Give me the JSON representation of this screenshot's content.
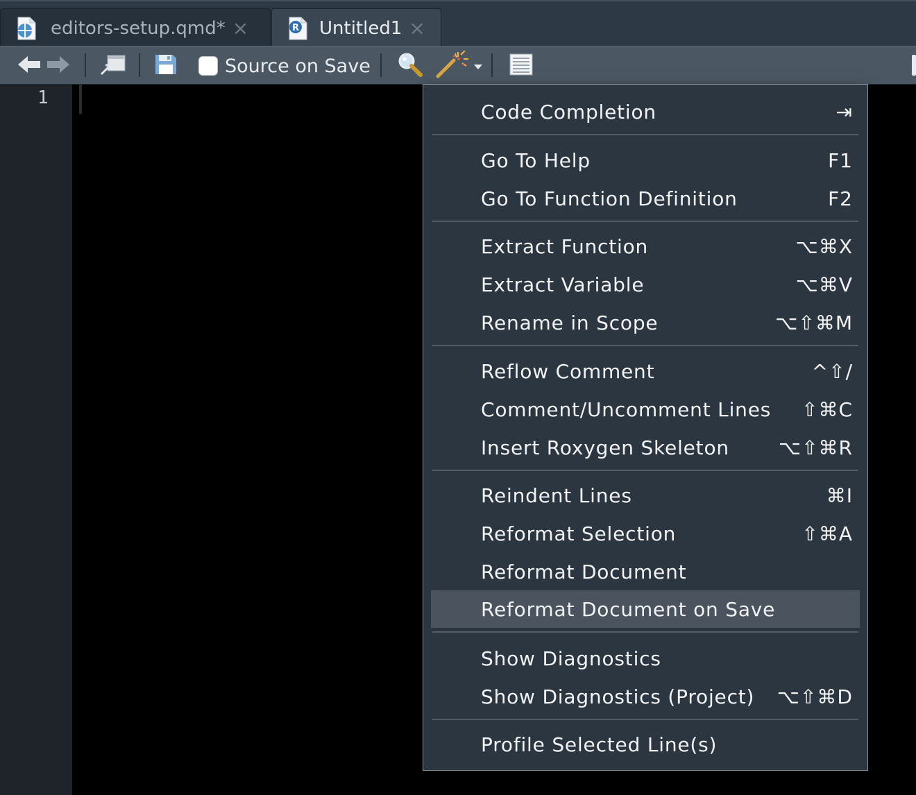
{
  "tabs": [
    {
      "label": "editors-setup.qmd*",
      "icon": "quarto-document-icon",
      "close": "×"
    },
    {
      "label": "Untitled1",
      "icon": "r-script-icon",
      "icon_letter": "R",
      "close": "×"
    }
  ],
  "toolbar": {
    "back_icon": "back-arrow-icon",
    "forward_icon": "forward-arrow-icon",
    "show_in_window_icon": "show-in-new-window-icon",
    "save_icon": "save-icon",
    "source_on_save_label": "Source on Save",
    "source_on_save_checked": false,
    "find_icon": "magnifier-icon",
    "code_tools_icon": "magic-wand-icon",
    "compile_report_icon": "notebook-icon"
  },
  "editor": {
    "line_numbers": [
      "1"
    ]
  },
  "menu": {
    "items": [
      {
        "label": "Code Completion",
        "shortcut": "⇥"
      },
      {
        "label": "Go To Help",
        "shortcut": "F1"
      },
      {
        "label": "Go To Function Definition",
        "shortcut": "F2"
      },
      {
        "label": "Extract Function",
        "shortcut": "⌥⌘X"
      },
      {
        "label": "Extract Variable",
        "shortcut": "⌥⌘V"
      },
      {
        "label": "Rename in Scope",
        "shortcut": "⌥⇧⌘M"
      },
      {
        "label": "Reflow Comment",
        "shortcut": "^⇧/"
      },
      {
        "label": "Comment/Uncomment Lines",
        "shortcut": "⇧⌘C"
      },
      {
        "label": "Insert Roxygen Skeleton",
        "shortcut": "⌥⇧⌘R"
      },
      {
        "label": "Reindent Lines",
        "shortcut": "⌘I"
      },
      {
        "label": "Reformat Selection",
        "shortcut": "⇧⌘A"
      },
      {
        "label": "Reformat Document",
        "shortcut": ""
      },
      {
        "label": "Reformat Document on Save",
        "shortcut": "",
        "highlighted": true
      },
      {
        "label": "Show Diagnostics",
        "shortcut": ""
      },
      {
        "label": "Show Diagnostics (Project)",
        "shortcut": "⌥⇧⌘D"
      },
      {
        "label": "Profile Selected Line(s)",
        "shortcut": ""
      }
    ]
  },
  "colors": {
    "background": "#000000",
    "tab_bar": "#2e3946",
    "toolbar": "#4b5864",
    "menu_background": "#2c3640",
    "menu_highlight": "#4b545e",
    "menu_text": "#f1f3f5"
  }
}
